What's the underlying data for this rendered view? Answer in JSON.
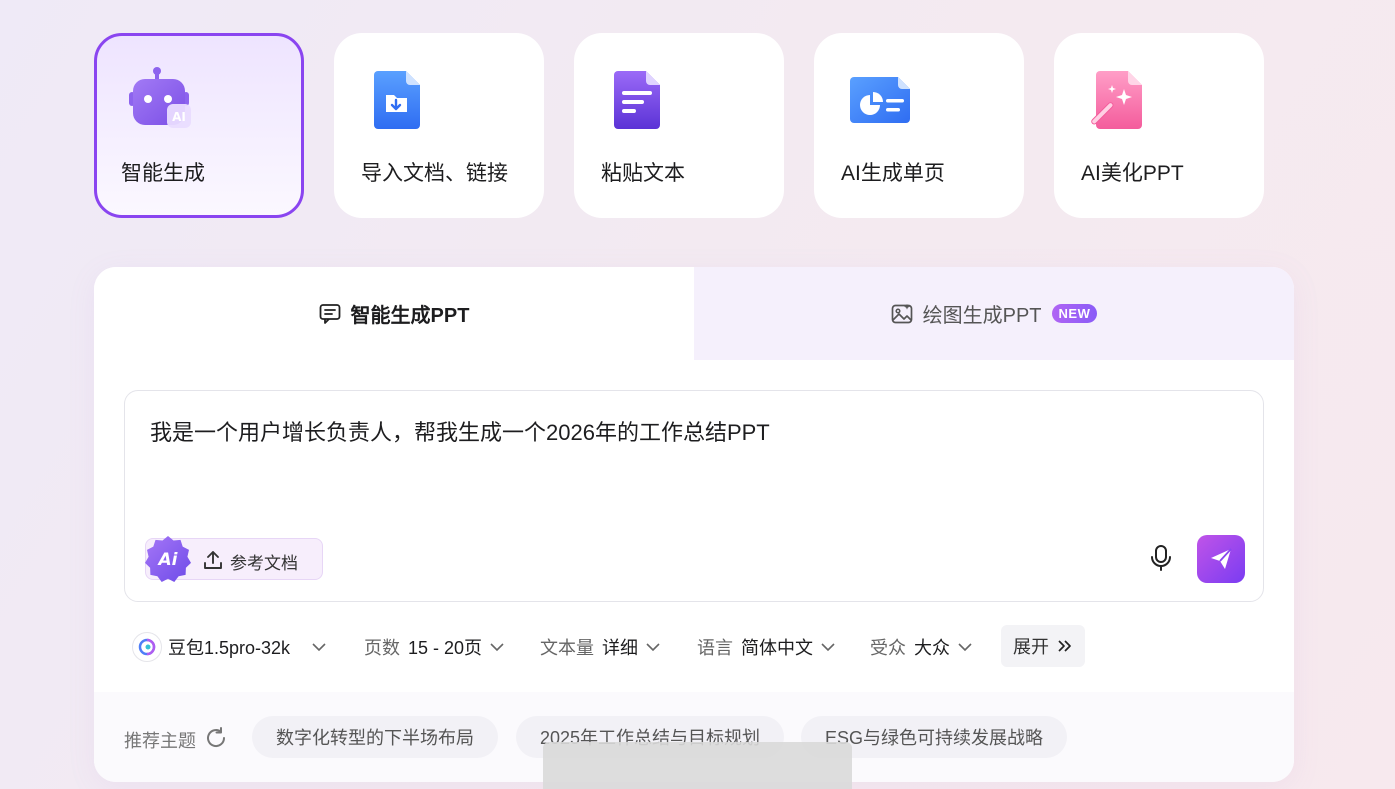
{
  "mode_cards": [
    {
      "label": "智能生成",
      "icon": "robot-ai-icon",
      "active": true
    },
    {
      "label": "导入文档、链接",
      "icon": "import-document-icon",
      "active": false
    },
    {
      "label": "粘贴文本",
      "icon": "paste-text-icon",
      "active": false
    },
    {
      "label": "AI生成单页",
      "icon": "single-page-icon",
      "active": false
    },
    {
      "label": "AI美化PPT",
      "icon": "beautify-wand-icon",
      "active": false
    }
  ],
  "tabs": {
    "smart": {
      "label": "智能生成PPT",
      "icon": "chat-icon"
    },
    "draw": {
      "label": "绘图生成PPT",
      "icon": "image-icon",
      "badge": "NEW"
    }
  },
  "prompt": {
    "value": "我是一个用户增长负责人，帮我生成一个2026年的工作总结PPT"
  },
  "ref_doc": {
    "ai_badge": "Ai",
    "label": "参考文档"
  },
  "options": {
    "model": "豆包1.5pro-32k",
    "pages": {
      "key": "页数",
      "value": "15 - 20页"
    },
    "amount": {
      "key": "文本量",
      "value": "详细"
    },
    "language": {
      "key": "语言",
      "value": "简体中文"
    },
    "audience": {
      "key": "受众",
      "value": "大众"
    },
    "expand": "展开"
  },
  "recommend": {
    "label": "推荐主题",
    "chips": [
      "数字化转型的下半场布局",
      "2025年工作总结与目标规划",
      "ESG与绿色可持续发展战略"
    ]
  },
  "colors": {
    "accent": "#8a45f0",
    "send_start": "#c054e8",
    "send_end": "#7a3cf2"
  }
}
